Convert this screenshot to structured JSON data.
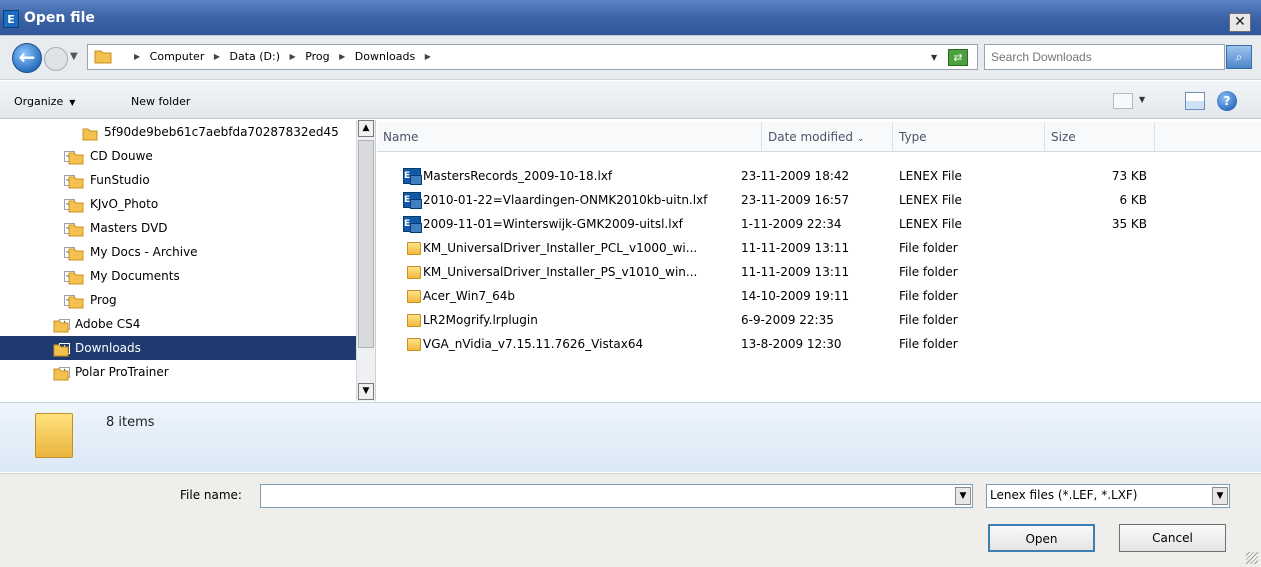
{
  "window": {
    "title": "Open file",
    "app_icon_letter": "E",
    "close_glyph": "✕"
  },
  "address": {
    "crumbs": [
      "Computer",
      "Data (D:)",
      "Prog",
      "Downloads"
    ],
    "search_placeholder": "Search Downloads"
  },
  "toolbar": {
    "organize_label": "Organize",
    "new_folder_label": "New folder"
  },
  "tree": {
    "items": [
      {
        "label": "5f90de9beb61c7aebfda70287832ed45",
        "expander": "",
        "selected": false
      },
      {
        "label": "CD Douwe",
        "expander": "+",
        "selected": false
      },
      {
        "label": "FunStudio",
        "expander": "+",
        "selected": false
      },
      {
        "label": "KJvO_Photo",
        "expander": "+",
        "selected": false
      },
      {
        "label": "Masters DVD",
        "expander": "+",
        "selected": false
      },
      {
        "label": "My Docs - Archive",
        "expander": "+",
        "selected": false
      },
      {
        "label": "My Documents",
        "expander": "+",
        "selected": false
      },
      {
        "label": "Prog",
        "expander": "−",
        "selected": false
      },
      {
        "label": "Adobe CS4",
        "expander": "+",
        "selected": false
      },
      {
        "label": "Downloads",
        "expander": "+",
        "selected": true
      },
      {
        "label": "Polar ProTrainer",
        "expander": "+",
        "selected": false
      }
    ]
  },
  "filelist": {
    "columns": {
      "name": "Name",
      "date": "Date modified",
      "type": "Type",
      "size": "Size"
    },
    "rows": [
      {
        "name": "MastersRecords_2009-10-18.lxf",
        "date": "23-11-2009 18:42",
        "type": "LENEX File",
        "size": "73 KB",
        "kind": "lxf"
      },
      {
        "name": "2010-01-22=Vlaardingen-ONMK2010kb-uitn.lxf",
        "date": "23-11-2009 16:57",
        "type": "LENEX File",
        "size": "6 KB",
        "kind": "lxf"
      },
      {
        "name": "2009-11-01=Winterswijk-GMK2009-uitsl.lxf",
        "date": "1-11-2009 22:34",
        "type": "LENEX File",
        "size": "35 KB",
        "kind": "lxf"
      },
      {
        "name": "KM_UniversalDriver_Installer_PCL_v1000_wi...",
        "date": "11-11-2009 13:11",
        "type": "File folder",
        "size": "",
        "kind": "folder"
      },
      {
        "name": "KM_UniversalDriver_Installer_PS_v1010_win...",
        "date": "11-11-2009 13:11",
        "type": "File folder",
        "size": "",
        "kind": "folder"
      },
      {
        "name": "Acer_Win7_64b",
        "date": "14-10-2009 19:11",
        "type": "File folder",
        "size": "",
        "kind": "folder"
      },
      {
        "name": "LR2Mogrify.lrplugin",
        "date": "6-9-2009 22:35",
        "type": "File folder",
        "size": "",
        "kind": "folder"
      },
      {
        "name": "VGA_nVidia_v7.15.11.7626_Vistax64",
        "date": "13-8-2009 12:30",
        "type": "File folder",
        "size": "",
        "kind": "folder"
      }
    ]
  },
  "details": {
    "count_text": "8 items"
  },
  "form": {
    "filename_label": "File name:",
    "filename_value": "",
    "filter_value": "Lenex files (*.LEF, *.LXF)",
    "open_label": "Open",
    "cancel_label": "Cancel"
  },
  "icons": {
    "back": "back-arrow-icon",
    "forward": "forward-arrow-icon",
    "folder": "folder-icon",
    "lxf": "lenex-file-icon",
    "search": "search-icon",
    "refresh": "refresh-icon",
    "views": "views-icon",
    "preview": "preview-pane-icon",
    "help": "help-icon"
  },
  "colors": {
    "title_bar": "#3d63a6",
    "selection": "#1e3a6e",
    "details_pane": "#dbe8f6"
  }
}
